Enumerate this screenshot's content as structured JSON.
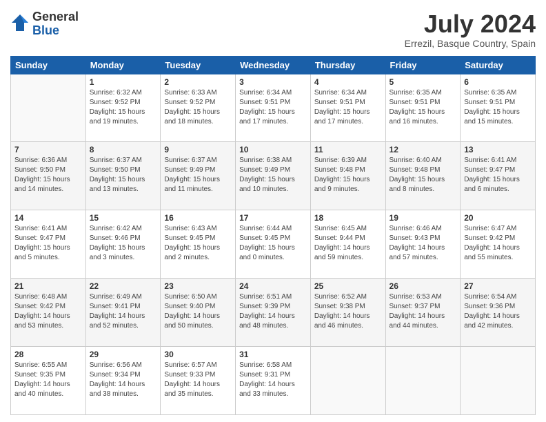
{
  "logo": {
    "general": "General",
    "blue": "Blue"
  },
  "title": "July 2024",
  "subtitle": "Errezil, Basque Country, Spain",
  "weekdays": [
    "Sunday",
    "Monday",
    "Tuesday",
    "Wednesday",
    "Thursday",
    "Friday",
    "Saturday"
  ],
  "weeks": [
    [
      {
        "day": "",
        "info": ""
      },
      {
        "day": "1",
        "info": "Sunrise: 6:32 AM\nSunset: 9:52 PM\nDaylight: 15 hours\nand 19 minutes."
      },
      {
        "day": "2",
        "info": "Sunrise: 6:33 AM\nSunset: 9:52 PM\nDaylight: 15 hours\nand 18 minutes."
      },
      {
        "day": "3",
        "info": "Sunrise: 6:34 AM\nSunset: 9:51 PM\nDaylight: 15 hours\nand 17 minutes."
      },
      {
        "day": "4",
        "info": "Sunrise: 6:34 AM\nSunset: 9:51 PM\nDaylight: 15 hours\nand 17 minutes."
      },
      {
        "day": "5",
        "info": "Sunrise: 6:35 AM\nSunset: 9:51 PM\nDaylight: 15 hours\nand 16 minutes."
      },
      {
        "day": "6",
        "info": "Sunrise: 6:35 AM\nSunset: 9:51 PM\nDaylight: 15 hours\nand 15 minutes."
      }
    ],
    [
      {
        "day": "7",
        "info": "Sunrise: 6:36 AM\nSunset: 9:50 PM\nDaylight: 15 hours\nand 14 minutes."
      },
      {
        "day": "8",
        "info": "Sunrise: 6:37 AM\nSunset: 9:50 PM\nDaylight: 15 hours\nand 13 minutes."
      },
      {
        "day": "9",
        "info": "Sunrise: 6:37 AM\nSunset: 9:49 PM\nDaylight: 15 hours\nand 11 minutes."
      },
      {
        "day": "10",
        "info": "Sunrise: 6:38 AM\nSunset: 9:49 PM\nDaylight: 15 hours\nand 10 minutes."
      },
      {
        "day": "11",
        "info": "Sunrise: 6:39 AM\nSunset: 9:48 PM\nDaylight: 15 hours\nand 9 minutes."
      },
      {
        "day": "12",
        "info": "Sunrise: 6:40 AM\nSunset: 9:48 PM\nDaylight: 15 hours\nand 8 minutes."
      },
      {
        "day": "13",
        "info": "Sunrise: 6:41 AM\nSunset: 9:47 PM\nDaylight: 15 hours\nand 6 minutes."
      }
    ],
    [
      {
        "day": "14",
        "info": "Sunrise: 6:41 AM\nSunset: 9:47 PM\nDaylight: 15 hours\nand 5 minutes."
      },
      {
        "day": "15",
        "info": "Sunrise: 6:42 AM\nSunset: 9:46 PM\nDaylight: 15 hours\nand 3 minutes."
      },
      {
        "day": "16",
        "info": "Sunrise: 6:43 AM\nSunset: 9:45 PM\nDaylight: 15 hours\nand 2 minutes."
      },
      {
        "day": "17",
        "info": "Sunrise: 6:44 AM\nSunset: 9:45 PM\nDaylight: 15 hours\nand 0 minutes."
      },
      {
        "day": "18",
        "info": "Sunrise: 6:45 AM\nSunset: 9:44 PM\nDaylight: 14 hours\nand 59 minutes."
      },
      {
        "day": "19",
        "info": "Sunrise: 6:46 AM\nSunset: 9:43 PM\nDaylight: 14 hours\nand 57 minutes."
      },
      {
        "day": "20",
        "info": "Sunrise: 6:47 AM\nSunset: 9:42 PM\nDaylight: 14 hours\nand 55 minutes."
      }
    ],
    [
      {
        "day": "21",
        "info": "Sunrise: 6:48 AM\nSunset: 9:42 PM\nDaylight: 14 hours\nand 53 minutes."
      },
      {
        "day": "22",
        "info": "Sunrise: 6:49 AM\nSunset: 9:41 PM\nDaylight: 14 hours\nand 52 minutes."
      },
      {
        "day": "23",
        "info": "Sunrise: 6:50 AM\nSunset: 9:40 PM\nDaylight: 14 hours\nand 50 minutes."
      },
      {
        "day": "24",
        "info": "Sunrise: 6:51 AM\nSunset: 9:39 PM\nDaylight: 14 hours\nand 48 minutes."
      },
      {
        "day": "25",
        "info": "Sunrise: 6:52 AM\nSunset: 9:38 PM\nDaylight: 14 hours\nand 46 minutes."
      },
      {
        "day": "26",
        "info": "Sunrise: 6:53 AM\nSunset: 9:37 PM\nDaylight: 14 hours\nand 44 minutes."
      },
      {
        "day": "27",
        "info": "Sunrise: 6:54 AM\nSunset: 9:36 PM\nDaylight: 14 hours\nand 42 minutes."
      }
    ],
    [
      {
        "day": "28",
        "info": "Sunrise: 6:55 AM\nSunset: 9:35 PM\nDaylight: 14 hours\nand 40 minutes."
      },
      {
        "day": "29",
        "info": "Sunrise: 6:56 AM\nSunset: 9:34 PM\nDaylight: 14 hours\nand 38 minutes."
      },
      {
        "day": "30",
        "info": "Sunrise: 6:57 AM\nSunset: 9:33 PM\nDaylight: 14 hours\nand 35 minutes."
      },
      {
        "day": "31",
        "info": "Sunrise: 6:58 AM\nSunset: 9:31 PM\nDaylight: 14 hours\nand 33 minutes."
      },
      {
        "day": "",
        "info": ""
      },
      {
        "day": "",
        "info": ""
      },
      {
        "day": "",
        "info": ""
      }
    ]
  ]
}
